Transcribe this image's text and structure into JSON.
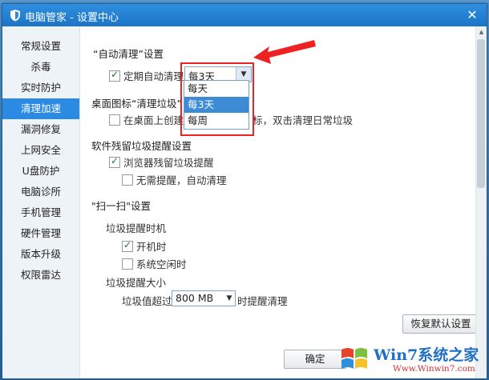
{
  "window": {
    "title": "电脑管家 - 设置中心"
  },
  "sidebar": {
    "items": [
      {
        "label": "常规设置"
      },
      {
        "label": "杀毒"
      },
      {
        "label": "实时防护"
      },
      {
        "label": "清理加速",
        "active": true
      },
      {
        "label": "漏洞修复"
      },
      {
        "label": "上网安全"
      },
      {
        "label": "U盘防护"
      },
      {
        "label": "电脑诊所"
      },
      {
        "label": "手机管理"
      },
      {
        "label": "硬件管理"
      },
      {
        "label": "版本升级"
      },
      {
        "label": "权限雷达"
      }
    ]
  },
  "auto_clean": {
    "heading": "“自动清理”设置",
    "periodic_label": "定期自动清理",
    "periodic_checked": true,
    "select_value": "每3天",
    "options": [
      "每天",
      "每3天",
      "每周"
    ],
    "selected_index": 1
  },
  "desktop_icon": {
    "heading": "桌面图标“清理垃圾”",
    "option_label_prefix": "在桌面上创建",
    "option_label_suffix": "标，双击清理日常垃圾",
    "option_checked": false
  },
  "residue": {
    "heading": "软件残留垃圾提醒设置",
    "browser_label": "浏览器残留垃圾提醒",
    "browser_checked": true,
    "silent_label": "无需提醒，自动清理",
    "silent_checked": false
  },
  "scan": {
    "heading": "\"扫一扫\"设置",
    "timing_heading": "垃圾提醒时机",
    "on_boot_label": "开机时",
    "on_boot_checked": true,
    "on_idle_label": "系统空闲时",
    "on_idle_checked": false,
    "size_heading": "垃圾提醒大小",
    "size_prefix": "垃圾值超过",
    "size_value": "800 MB",
    "size_suffix": "时提醒清理"
  },
  "buttons": {
    "restore": "恢复默认设置",
    "ok": "确定"
  },
  "watermark": {
    "brand": "Win7系统之家",
    "url": "Www.Winwin7.com"
  },
  "colors": {
    "accent": "#2b8be3",
    "title_bar": "#1c74c6",
    "highlight_box": "#ee2222"
  }
}
